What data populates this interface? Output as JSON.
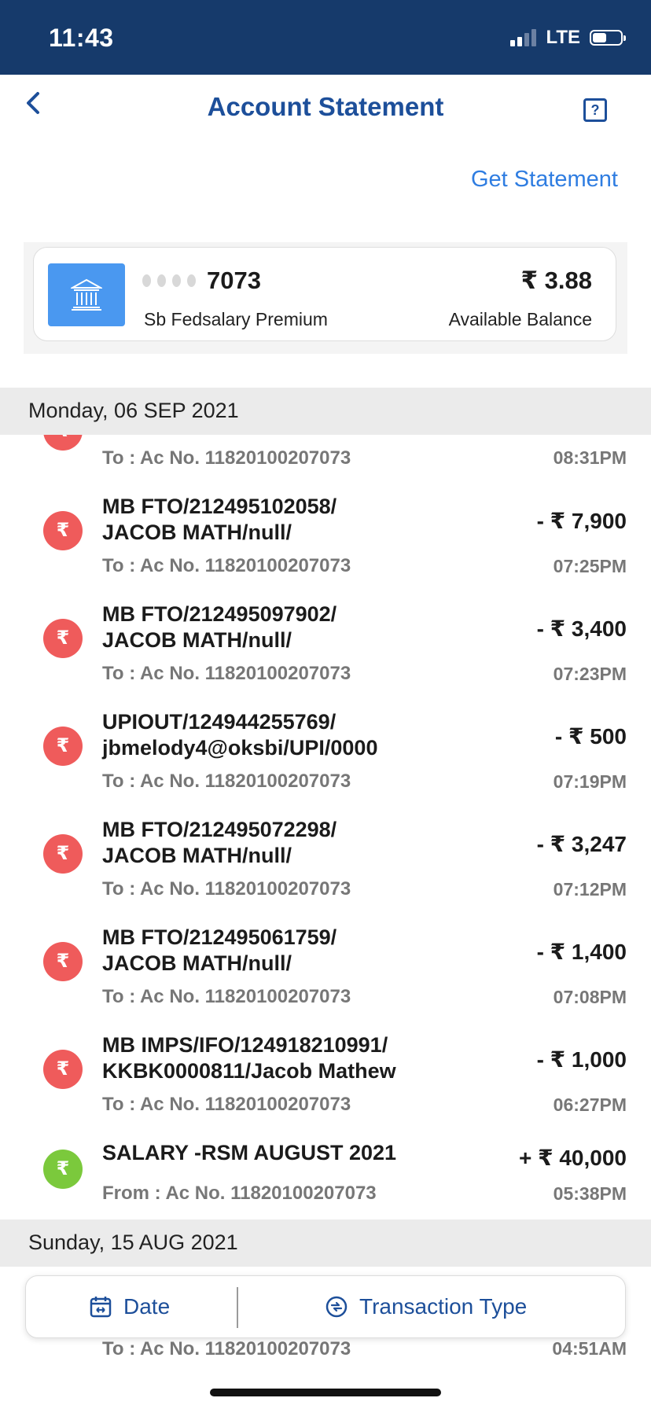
{
  "status_bar": {
    "time": "11:43",
    "network": "LTE",
    "battery_level": 0.5
  },
  "header": {
    "title": "Account Statement",
    "back_icon": "chevron-left-icon",
    "help_icon": "question-square-icon"
  },
  "get_statement_label": "Get Statement",
  "account": {
    "masked_dots": "••••",
    "last_digits": "7073",
    "name": "Sb Fedsalary Premium",
    "balance": "₹ 3.88",
    "balance_label": "Available Balance",
    "icon": "bank-icon"
  },
  "sections": [
    {
      "date": "Monday, 06 SEP 2021"
    },
    {
      "date": "Sunday, 15 AUG 2021"
    }
  ],
  "partial_top": {
    "account": "To : Ac No. 11820100207073",
    "time": "08:31PM"
  },
  "transactions": [
    {
      "type": "debit",
      "desc_line1": "MB FTO/212495102058/",
      "desc_line2": "JACOB MATH/null/",
      "account": "To : Ac No. 11820100207073",
      "amount": "- ₹ 7,900",
      "time": "07:25PM"
    },
    {
      "type": "debit",
      "desc_line1": "MB FTO/212495097902/",
      "desc_line2": "JACOB MATH/null/",
      "account": "To : Ac No. 11820100207073",
      "amount": "- ₹ 3,400",
      "time": "07:23PM"
    },
    {
      "type": "debit",
      "desc_line1": "UPIOUT/124944255769/",
      "desc_line2": "jbmelody4@oksbi/UPI/0000",
      "account": "To : Ac No. 11820100207073",
      "amount": "- ₹ 500",
      "time": "07:19PM"
    },
    {
      "type": "debit",
      "desc_line1": "MB FTO/212495072298/",
      "desc_line2": "JACOB MATH/null/",
      "account": "To : Ac No. 11820100207073",
      "amount": "- ₹ 3,247",
      "time": "07:12PM"
    },
    {
      "type": "debit",
      "desc_line1": "MB FTO/212495061759/",
      "desc_line2": "JACOB MATH/null/",
      "account": "To : Ac No. 11820100207073",
      "amount": "- ₹ 1,400",
      "time": "07:08PM"
    },
    {
      "type": "debit",
      "desc_line1": "MB IMPS/IFO/124918210991/",
      "desc_line2": "KKBK0000811/Jacob Mathew",
      "account": "To : Ac No. 11820100207073",
      "amount": "- ₹ 1,000",
      "time": "06:27PM"
    },
    {
      "type": "credit",
      "desc_line1": "SALARY -RSM AUGUST 2021",
      "desc_line2": "",
      "account": "From : Ac No. 11820100207073",
      "amount": "+ ₹ 40,000",
      "time": "05:38PM"
    }
  ],
  "partial_bottom": {
    "account": "To : Ac No. 11820100207073",
    "time": "04:51AM"
  },
  "filters": {
    "date_label": "Date",
    "date_icon": "calendar-icon",
    "type_label": "Transaction Type",
    "type_icon": "transaction-type-icon"
  },
  "colors": {
    "status_bar": "#163a6b",
    "primary": "#1d4f9a",
    "link": "#2f7de1",
    "debit": "#ef5b5b",
    "credit": "#7bc93c",
    "bank_tile": "#4a98f0"
  }
}
